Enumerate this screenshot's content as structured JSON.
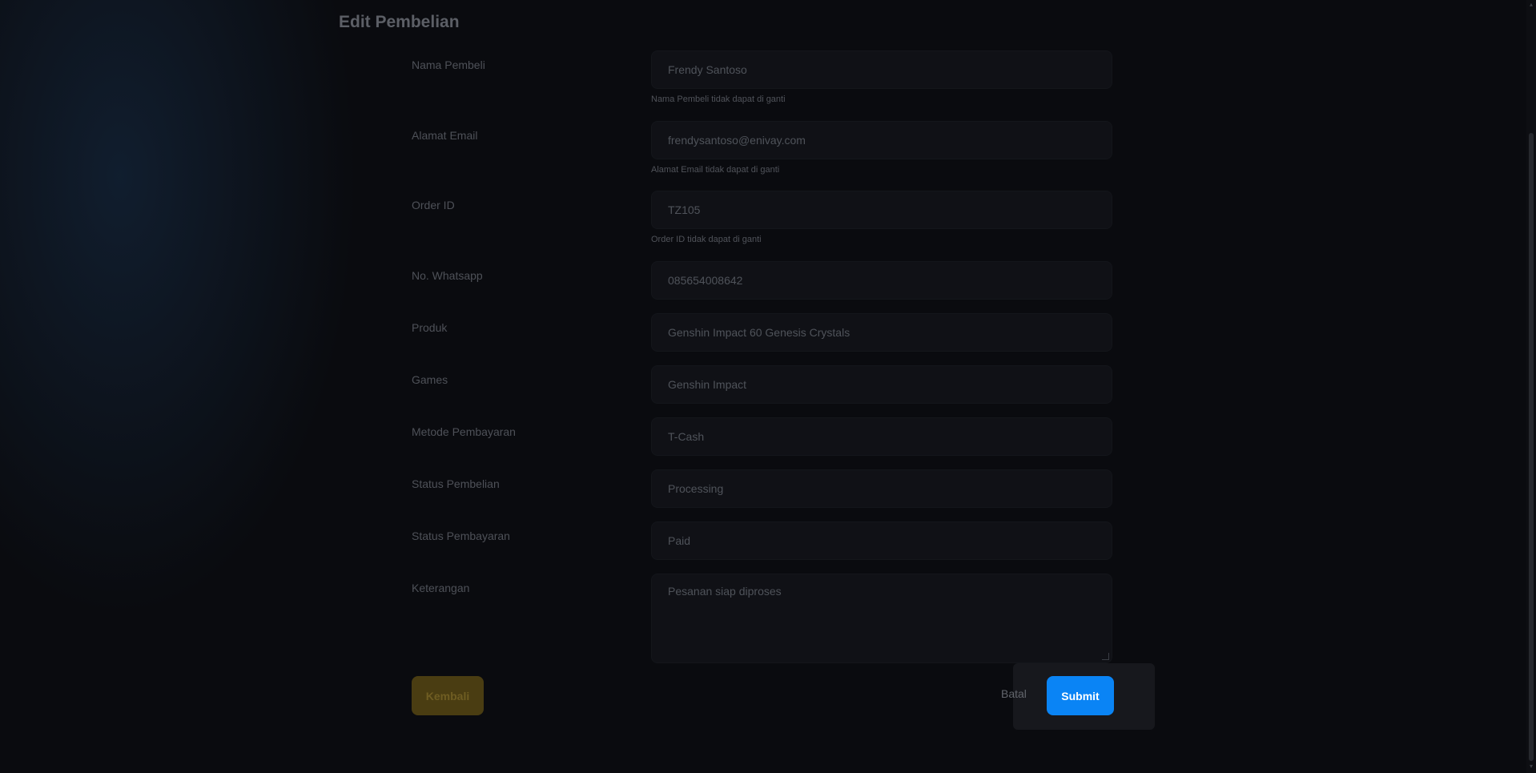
{
  "page": {
    "title": "Edit Pembelian"
  },
  "form": {
    "fields": [
      {
        "label": "Nama Pembeli",
        "value": "Frendy Santoso",
        "hint": "Nama Pembeli tidak dapat di ganti"
      },
      {
        "label": "Alamat Email",
        "value": "frendysantoso@enivay.com",
        "hint": "Alamat Email tidak dapat di ganti"
      },
      {
        "label": "Order ID",
        "value": "TZ105",
        "hint": "Order ID tidak dapat di ganti"
      },
      {
        "label": "No. Whatsapp",
        "value": "085654008642"
      },
      {
        "label": "Produk",
        "value": "Genshin Impact 60 Genesis Crystals"
      },
      {
        "label": "Games",
        "value": "Genshin Impact"
      },
      {
        "label": "Metode Pembayaran",
        "value": "T-Cash"
      },
      {
        "label": "Status Pembelian",
        "value": "Processing"
      },
      {
        "label": "Status Pembayaran",
        "value": "Paid"
      },
      {
        "label": "Keterangan",
        "value": "Pesanan siap diproses"
      }
    ]
  },
  "actions": {
    "back_label": "Kembali",
    "cancel_label": "Batal",
    "submit_label": "Submit"
  },
  "colors": {
    "accent": "#0a84f5",
    "back_button": "#4a3d12"
  },
  "icons": {
    "scroll_up": "chevron-up-icon",
    "scroll_down": "chevron-down-icon"
  }
}
